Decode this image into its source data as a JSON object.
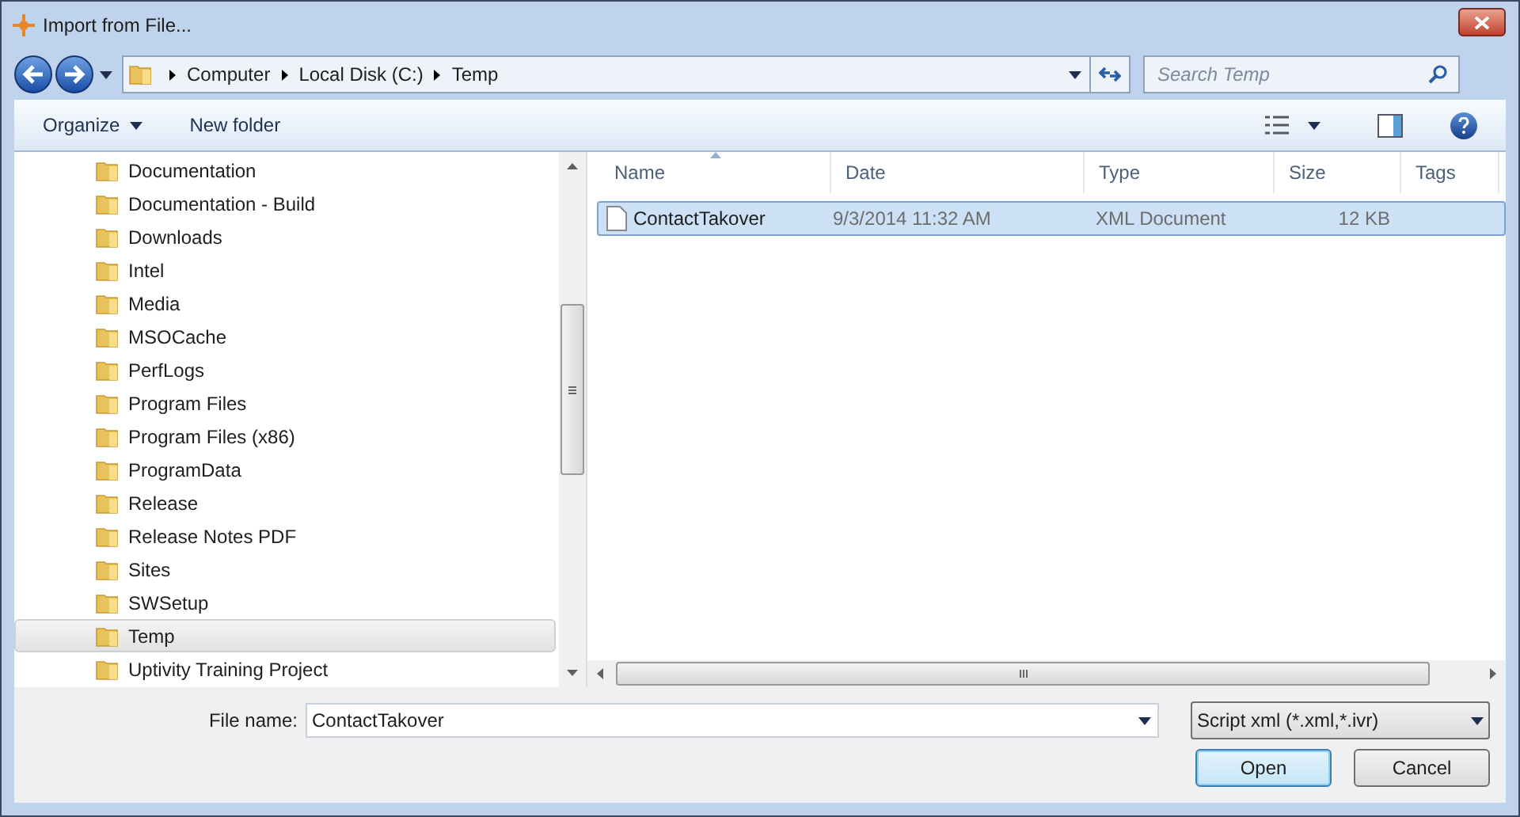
{
  "window": {
    "title": "Import from File..."
  },
  "address": {
    "crumbs": [
      "Computer",
      "Local Disk (C:)",
      "Temp"
    ]
  },
  "search": {
    "placeholder": "Search Temp"
  },
  "toolbar": {
    "organize": "Organize",
    "new_folder": "New folder"
  },
  "folders": [
    {
      "name": "Documentation",
      "selected": false
    },
    {
      "name": "Documentation - Build",
      "selected": false
    },
    {
      "name": "Downloads",
      "selected": false
    },
    {
      "name": "Intel",
      "selected": false
    },
    {
      "name": "Media",
      "selected": false
    },
    {
      "name": "MSOCache",
      "selected": false
    },
    {
      "name": "PerfLogs",
      "selected": false
    },
    {
      "name": "Program Files",
      "selected": false
    },
    {
      "name": "Program Files (x86)",
      "selected": false
    },
    {
      "name": "ProgramData",
      "selected": false
    },
    {
      "name": "Release",
      "selected": false
    },
    {
      "name": "Release Notes PDF",
      "selected": false
    },
    {
      "name": "Sites",
      "selected": false
    },
    {
      "name": "SWSetup",
      "selected": false
    },
    {
      "name": "Temp",
      "selected": true
    },
    {
      "name": "Uptivity Training Project",
      "selected": false
    }
  ],
  "columns": [
    {
      "label": "Name",
      "sorted": true
    },
    {
      "label": "Date",
      "sorted": false
    },
    {
      "label": "Type",
      "sorted": false
    },
    {
      "label": "Size",
      "sorted": false
    },
    {
      "label": "Tags",
      "sorted": false
    }
  ],
  "files": [
    {
      "name": "ContactTakover",
      "date": "9/3/2014 11:32 AM",
      "type": "XML Document",
      "size": "12 KB",
      "selected": true
    }
  ],
  "file_name": {
    "label": "File name:",
    "value": "ContactTakover"
  },
  "file_type": {
    "value": "Script xml (*.xml,*.ivr)"
  },
  "buttons": [
    {
      "label": "Open",
      "default": true
    },
    {
      "label": "Cancel",
      "default": false
    }
  ]
}
